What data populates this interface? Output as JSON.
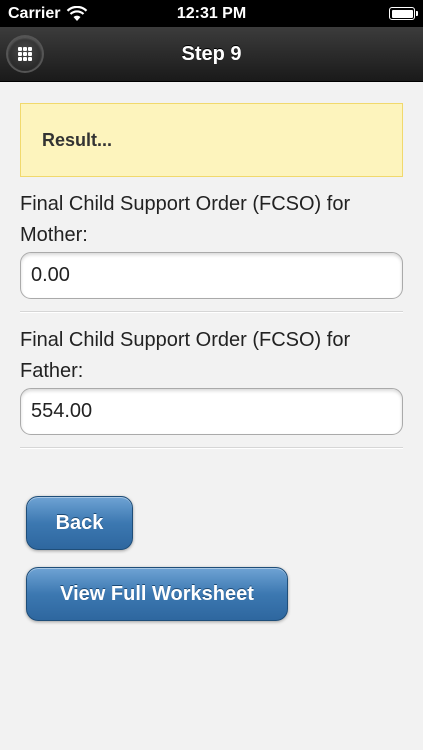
{
  "status_bar": {
    "carrier": "Carrier",
    "time": "12:31 PM",
    "icons": [
      "wifi-icon",
      "battery-icon"
    ]
  },
  "header": {
    "title": "Step 9",
    "menu_icon": "grid-icon"
  },
  "result": {
    "text": "Result..."
  },
  "fields": {
    "mother": {
      "label": "Final Child Support Order (FCSO) for Mother:",
      "value": "0.00"
    },
    "father": {
      "label": "Final Child Support Order (FCSO) for Father:",
      "value": "554.00"
    }
  },
  "buttons": {
    "back": "Back",
    "view_full": "View Full Worksheet"
  },
  "colors": {
    "header_bg": "#2a2a2a",
    "result_bg": "#fdf4bd",
    "button_blue": "#3c78b1"
  }
}
